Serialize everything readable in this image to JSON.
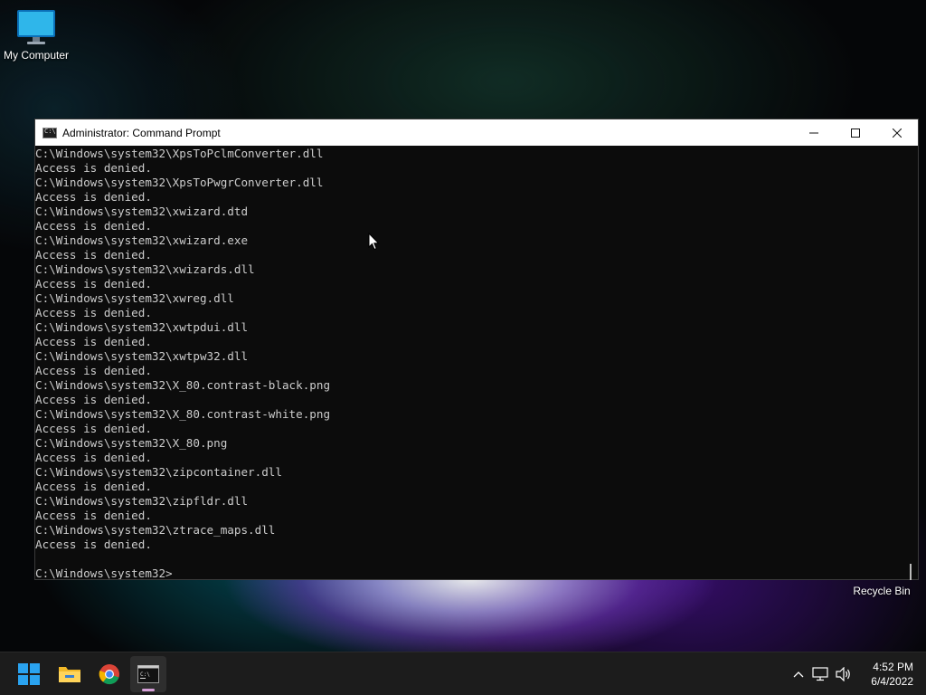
{
  "desktop": {
    "icons": [
      {
        "label": "My Computer",
        "icon": "computer-icon"
      },
      {
        "label": "Recycle Bin",
        "icon": "recycle-bin-icon"
      }
    ]
  },
  "window": {
    "title": "Administrator: Command Prompt",
    "icon": "cmd-icon",
    "controls": {
      "minimize": "minimize-icon",
      "maximize": "maximize-icon",
      "close": "close-icon"
    }
  },
  "console": {
    "lines": [
      "C:\\Windows\\system32\\XpsToPclmConverter.dll",
      "Access is denied.",
      "C:\\Windows\\system32\\XpsToPwgrConverter.dll",
      "Access is denied.",
      "C:\\Windows\\system32\\xwizard.dtd",
      "Access is denied.",
      "C:\\Windows\\system32\\xwizard.exe",
      "Access is denied.",
      "C:\\Windows\\system32\\xwizards.dll",
      "Access is denied.",
      "C:\\Windows\\system32\\xwreg.dll",
      "Access is denied.",
      "C:\\Windows\\system32\\xwtpdui.dll",
      "Access is denied.",
      "C:\\Windows\\system32\\xwtpw32.dll",
      "Access is denied.",
      "C:\\Windows\\system32\\X_80.contrast-black.png",
      "Access is denied.",
      "C:\\Windows\\system32\\X_80.contrast-white.png",
      "Access is denied.",
      "C:\\Windows\\system32\\X_80.png",
      "Access is denied.",
      "C:\\Windows\\system32\\zipcontainer.dll",
      "Access is denied.",
      "C:\\Windows\\system32\\zipfldr.dll",
      "Access is denied.",
      "C:\\Windows\\system32\\ztrace_maps.dll",
      "Access is denied.",
      "",
      "C:\\Windows\\system32>"
    ]
  },
  "taskbar": {
    "apps": [
      {
        "name": "start",
        "icon": "windows-start-icon"
      },
      {
        "name": "file-explorer",
        "icon": "folder-icon"
      },
      {
        "name": "chrome",
        "icon": "chrome-icon"
      },
      {
        "name": "command-prompt",
        "icon": "cmd-icon",
        "active": true
      }
    ],
    "tray": {
      "icons": [
        "chevron-up-icon",
        "network-icon",
        "volume-icon"
      ],
      "time": "4:52 PM",
      "date": "6/4/2022"
    }
  }
}
